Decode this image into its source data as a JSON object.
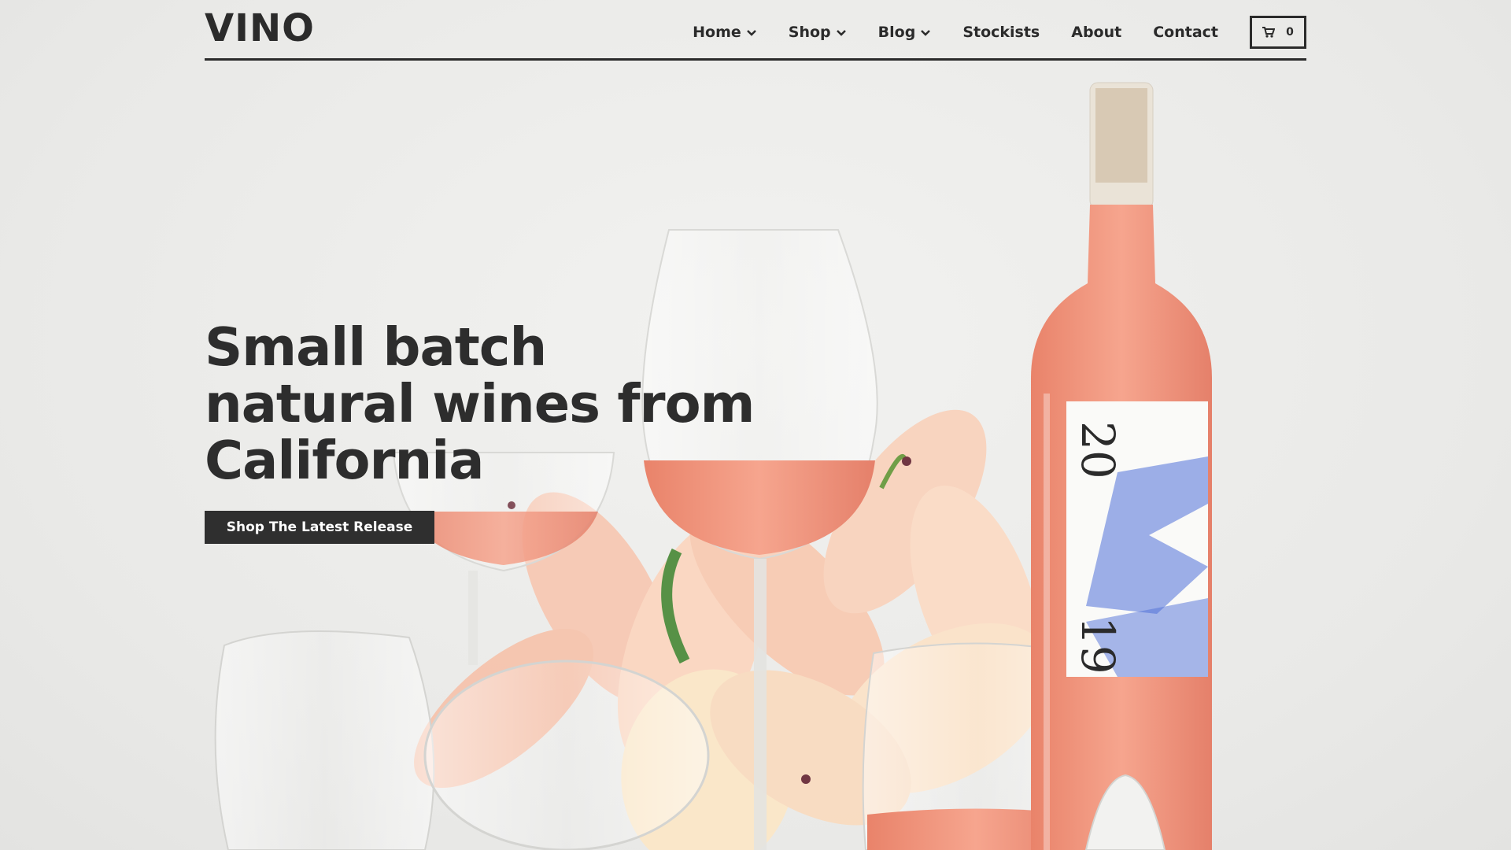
{
  "brand": {
    "logo": "VINO"
  },
  "nav": {
    "items": [
      {
        "label": "Home",
        "has_dropdown": true
      },
      {
        "label": "Shop",
        "has_dropdown": true
      },
      {
        "label": "Blog",
        "has_dropdown": true
      },
      {
        "label": "Stockists",
        "has_dropdown": false
      },
      {
        "label": "About",
        "has_dropdown": false
      },
      {
        "label": "Contact",
        "has_dropdown": false
      }
    ],
    "cart_count": "0",
    "cart_icon": "cart-icon",
    "dropdown_icon": "chevron-down-icon"
  },
  "hero": {
    "headline": "Small batch natural wines from California",
    "cta_label": "Shop The Latest Release",
    "bottle_label_year_top": "20",
    "bottle_label_year_bottom": "19"
  },
  "colors": {
    "text": "#2b2b2b",
    "background": "#ececea",
    "button": "#2f2f2f",
    "wine": "#f0957c",
    "label_blue": "#4f6fd8"
  }
}
